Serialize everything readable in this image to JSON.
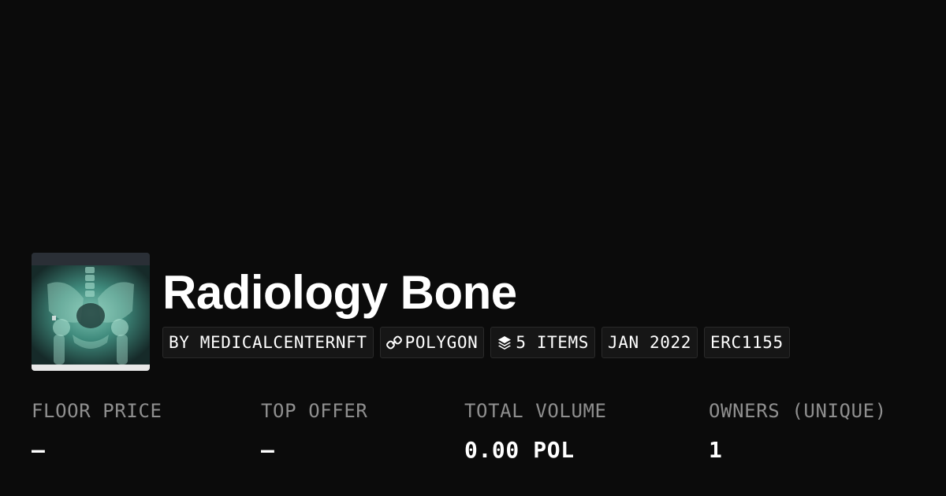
{
  "collection": {
    "title": "Radiology Bone",
    "thumbnail_icon": "xray-pelvis-image"
  },
  "badges": [
    {
      "label": "BY MEDICALCENTERNFT",
      "icon": null
    },
    {
      "label": "POLYGON",
      "icon": "chain-link-icon"
    },
    {
      "label": "5 ITEMS",
      "icon": "layers-icon"
    },
    {
      "label": "JAN 2022",
      "icon": null
    },
    {
      "label": "ERC1155",
      "icon": null
    }
  ],
  "stats": [
    {
      "label": "FLOOR PRICE",
      "value": "–"
    },
    {
      "label": "TOP OFFER",
      "value": "–"
    },
    {
      "label": "TOTAL VOLUME",
      "value": "0.00 POL"
    },
    {
      "label": "OWNERS (UNIQUE)",
      "value": "1"
    }
  ],
  "colors": {
    "background": "#0b0b0b",
    "text": "#ffffff",
    "muted": "#8f8f8f",
    "badge_bg": "#161616",
    "badge_border": "#2a2a2a"
  }
}
